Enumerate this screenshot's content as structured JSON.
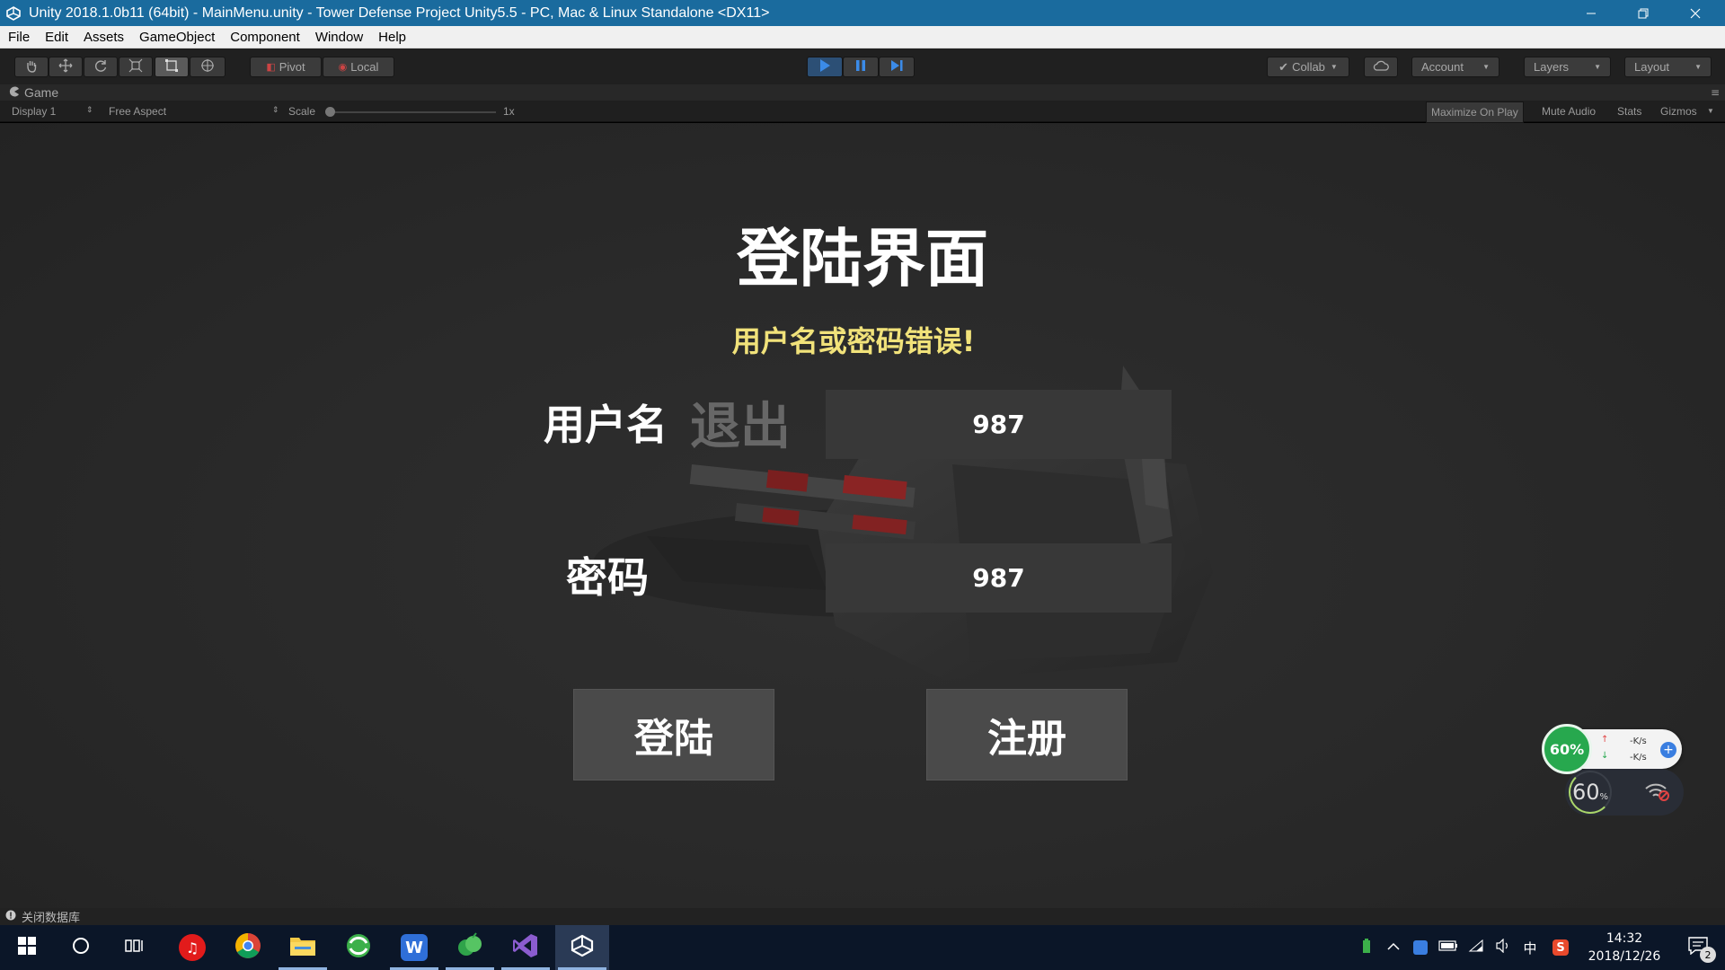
{
  "window": {
    "title": "Unity 2018.1.0b11 (64bit) - MainMenu.unity - Tower Defense Project Unity5.5 - PC, Mac & Linux Standalone <DX11>"
  },
  "menu": [
    "File",
    "Edit",
    "Assets",
    "GameObject",
    "Component",
    "Window",
    "Help"
  ],
  "toolbar": {
    "pivot_label": "Pivot",
    "local_label": "Local",
    "collab_label": "Collab",
    "account_label": "Account",
    "layers_label": "Layers",
    "layout_label": "Layout"
  },
  "game_view": {
    "tab_label": "Game",
    "display": "Display 1",
    "aspect": "Free Aspect",
    "scale_label": "Scale",
    "scale_value": "1x",
    "maximize_label": "Maximize On Play",
    "mute_label": "Mute Audio",
    "stats_label": "Stats",
    "gizmos_label": "Gizmos"
  },
  "login_screen": {
    "title": "登陆界面",
    "error_message": "用户名或密码错误!",
    "username_label": "用户名",
    "exit_label": "退出",
    "username_value": "987",
    "password_label": "密码",
    "password_value": "987",
    "login_button": "登陆",
    "register_button": "注册"
  },
  "status_bar": {
    "message": "关闭数据库"
  },
  "net_widget": {
    "cpu_percent": "60%",
    "up_speed": "-K/s",
    "down_speed": "-K/s",
    "fps_value": "60",
    "fps_unit": "%"
  },
  "taskbar": {
    "time": "14:32",
    "date": "2018/12/26",
    "ime": "中",
    "notification_count": "2"
  },
  "colors": {
    "titlebar": "#1a6b9e",
    "error_text": "#f1e27a",
    "play_blue": "#3b8be8"
  }
}
